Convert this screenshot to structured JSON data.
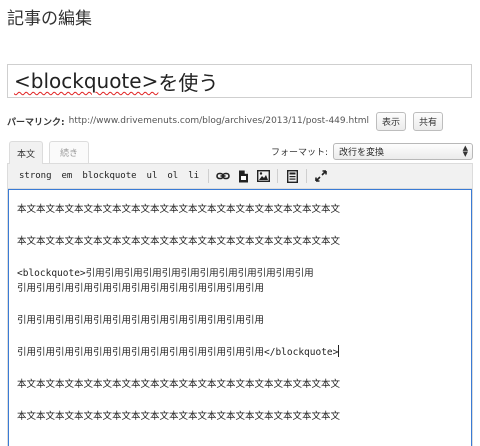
{
  "page": {
    "heading": "記事の編集"
  },
  "post": {
    "title_tag": "<blockquote>",
    "title_suffix": "を使う"
  },
  "permalink": {
    "label": "パーマリンク:",
    "url": "http://www.drivemenuts.com/blog/archives/2013/11/post-449.html",
    "view_button": "表示",
    "share_button": "共有"
  },
  "tabs": [
    {
      "label": "本文",
      "active": true
    },
    {
      "label": "続き",
      "active": false
    }
  ],
  "format": {
    "label": "フォーマット:",
    "selected": "改行を変換"
  },
  "toolbar": {
    "buttons": [
      "strong",
      "em",
      "blockquote",
      "ul",
      "ol",
      "li"
    ],
    "icons": [
      "link-icon",
      "file-icon",
      "image-icon",
      "asset-icon",
      "fullscreen-icon"
    ]
  },
  "content": {
    "line1": "本文本文本文本文本文本文本文本文本文本文本文本文本文本文本文本文本文",
    "line2": "本文本文本文本文本文本文本文本文本文本文本文本文本文本文本文本文本文",
    "line3": "<blockquote>引用引用引用引用引用引用引用引用引用引用引用引用",
    "line4": "引用引用引用引用引用引用引用引用引用引用引用引用引用",
    "line5": "引用引用引用引用引用引用引用引用引用引用引用引用引用",
    "line6": "引用引用引用引用引用引用引用引用引用引用引用引用引用</blockquote>",
    "line7": "本文本文本文本文本文本文本文本文本文本文本文本文本文本文本文本文本文",
    "line8": "本文本文本文本文本文本文本文本文本文本文本文本文本文本文本文本文本文"
  },
  "colors": {
    "focus_border": "#3a7bd5",
    "spellcheck": "#e02020"
  }
}
